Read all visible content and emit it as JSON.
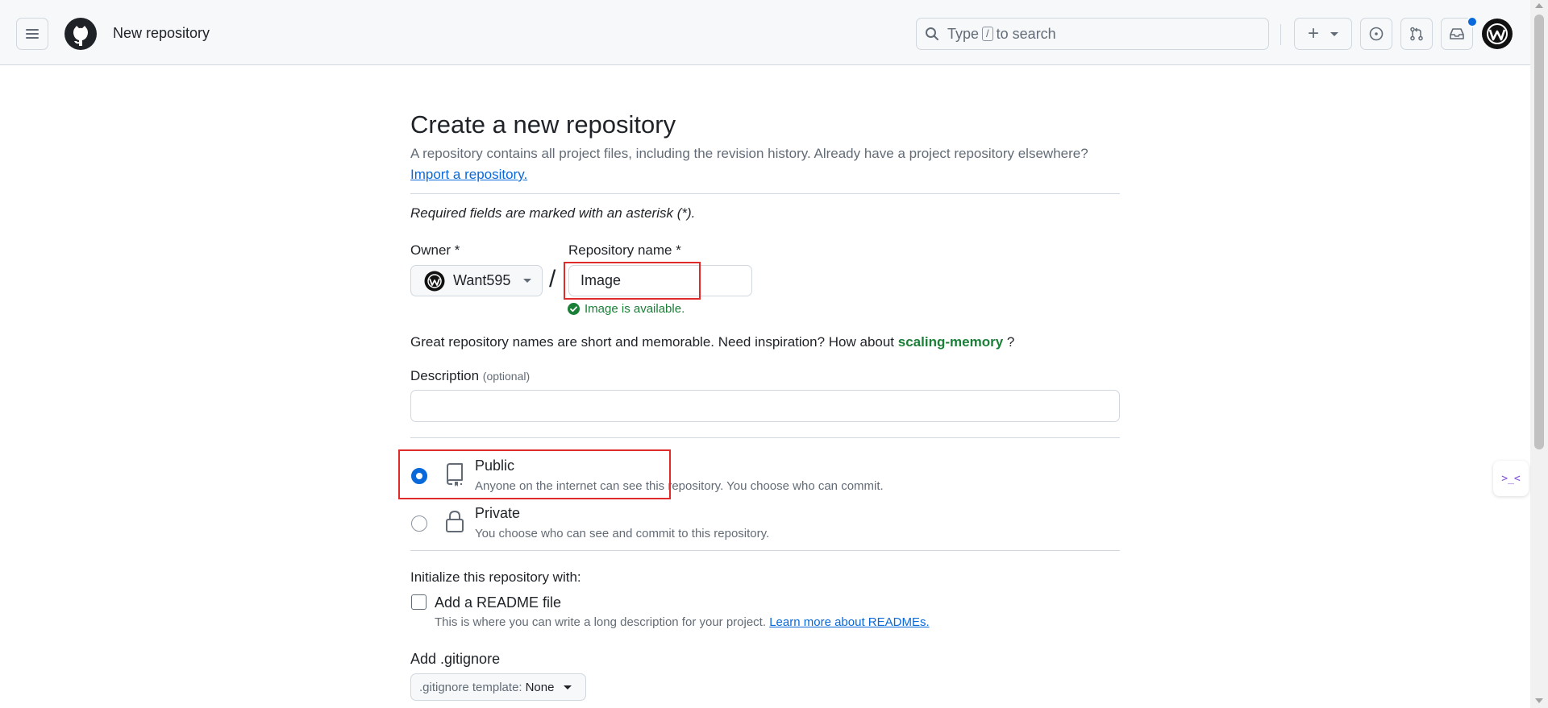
{
  "header": {
    "context": "New repository",
    "search_prefix": "Type",
    "search_key": "/",
    "search_suffix": "to search",
    "plus_label": "+"
  },
  "page": {
    "title": "Create a new repository",
    "intro": "A repository contains all project files, including the revision history. Already have a project repository elsewhere?",
    "import_link": "Import a repository.",
    "required_note": "Required fields are marked with an asterisk (*)."
  },
  "form": {
    "owner_label": "Owner *",
    "owner_value": "Want595",
    "slash": "/",
    "repo_name_label": "Repository name *",
    "repo_name_value": "Image",
    "availability": "Image is available.",
    "suggestion_prefix": "Great repository names are short and memorable. Need inspiration? How about",
    "suggestion_name": "scaling-memory",
    "suggestion_suffix": "?",
    "description_label": "Description",
    "description_optional": "(optional)",
    "description_value": ""
  },
  "visibility": {
    "selected": "public",
    "public_title": "Public",
    "public_desc": "Anyone on the internet can see this repository. You choose who can commit.",
    "private_title": "Private",
    "private_desc": "You choose who can see and commit to this repository."
  },
  "initialize": {
    "label": "Initialize this repository with:",
    "readme_label": "Add a README file",
    "readme_checked": false,
    "readme_desc": "This is where you can write a long description for your project.",
    "readme_link": "Learn more about READMEs.",
    "gitignore_label": "Add .gitignore",
    "gitignore_prefix": ".gitignore template:",
    "gitignore_value": "None"
  },
  "colors": {
    "accent": "#0969da",
    "success": "#1a7f37",
    "highlight": "#e02b2b"
  },
  "icons": [
    "hamburger-icon",
    "github-logo-icon",
    "search-icon",
    "plus-icon",
    "chevron-down-icon",
    "issue-icon",
    "pull-request-icon",
    "inbox-icon",
    "check-circle-icon",
    "repo-icon",
    "lock-icon",
    "copilot-icon"
  ]
}
